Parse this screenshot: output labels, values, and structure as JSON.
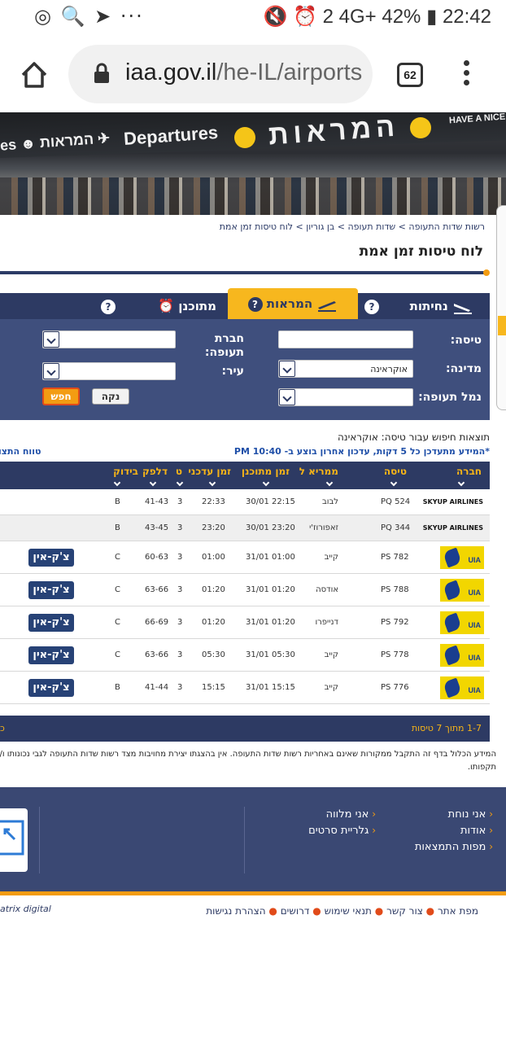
{
  "status_bar": {
    "left_icons": "◎ 🔍 ➤ ···",
    "right_info": "🔇 ⏰ 2 4G+ 42% ▮ 22:42",
    "battery": "42%",
    "time": "22:42"
  },
  "browser": {
    "url_host": "iaa.gov.il",
    "url_path": "/he-IL/airports",
    "tab_count": "62"
  },
  "banner": {
    "sign_hebrew_left": "es ☻ המראות ✈",
    "sign_departures": "Departures",
    "sign_hebrew_main": "המראות",
    "sign_welcome": "HAVE A NICE"
  },
  "breadcrumb": {
    "items": [
      "רשות שדות התעופה",
      "שדות תעופה",
      "בן גוריון",
      "לוח טיסות זמן אמת"
    ],
    "sep": " > "
  },
  "page_title": "לוח טיסות זמן אמת",
  "tabs": {
    "landings": "נחיתות",
    "departures": "המראות",
    "planned": "מתוכנן",
    "help": "?"
  },
  "search": {
    "flight_label": "טיסה:",
    "flight_value": "",
    "country_label": "מדינה:",
    "country_value": "אוקראינה",
    "airport_label": "נמל תעופה:",
    "airport_value": "",
    "airline_label": "חברת תעופה:",
    "airline_value": "",
    "city_label": "עיר:",
    "city_value": "",
    "clear_button": "נקה",
    "search_button": "חפש"
  },
  "results": {
    "header": "תוצאות חיפוש עבור טיסה: אוקראינה",
    "note": "*המידע מתעדכן כל 5 דקות, עדכון אחרון בוצע ב- 10:40 PM",
    "time_range_link": "טווח התצו",
    "columns": [
      "חברה",
      "טיסה",
      "ממריא ל",
      "זמן מתוכנן",
      "זמן עדכני",
      "ט",
      "דלפק",
      "בידוק"
    ],
    "rows": [
      {
        "airline": "SKYUP AIRLINES",
        "logo": false,
        "flight": "PQ 524",
        "dest": "לבוב",
        "scheduled": "22:15 30/01",
        "updated": "22:33",
        "terminal": "3",
        "counter": "41-43",
        "check": "B",
        "checkin": ""
      },
      {
        "airline": "SKYUP AIRLINES",
        "logo": false,
        "flight": "PQ 344",
        "dest": "זאפורוז'י",
        "scheduled": "23:20 30/01",
        "updated": "23:20",
        "terminal": "3",
        "counter": "43-45",
        "check": "B",
        "checkin": ""
      },
      {
        "airline": "UIA",
        "logo": true,
        "flight": "PS 782",
        "dest": "קייב",
        "scheduled": "01:00 31/01",
        "updated": "01:00",
        "terminal": "3",
        "counter": "60-63",
        "check": "C",
        "checkin": "צ'ק-אין"
      },
      {
        "airline": "UIA",
        "logo": true,
        "flight": "PS 788",
        "dest": "אודסה",
        "scheduled": "01:20 31/01",
        "updated": "01:20",
        "terminal": "3",
        "counter": "63-66",
        "check": "C",
        "checkin": "צ'ק-אין"
      },
      {
        "airline": "UIA",
        "logo": true,
        "flight": "PS 792",
        "dest": "דנייפרו",
        "scheduled": "01:20 31/01",
        "updated": "01:20",
        "terminal": "3",
        "counter": "66-69",
        "check": "C",
        "checkin": "צ'ק-אין"
      },
      {
        "airline": "UIA",
        "logo": true,
        "flight": "PS 778",
        "dest": "קייב",
        "scheduled": "05:30 31/01",
        "updated": "05:30",
        "terminal": "3",
        "counter": "63-66",
        "check": "C",
        "checkin": "צ'ק-אין"
      },
      {
        "airline": "UIA",
        "logo": true,
        "flight": "PS 776",
        "dest": "קייב",
        "scheduled": "15:15 31/01",
        "updated": "15:15",
        "terminal": "3",
        "counter": "41-44",
        "check": "B",
        "checkin": "צ'ק-אין"
      }
    ],
    "footer_count": "1-7 מתוך 7 טיסות",
    "footer_more": "כ"
  },
  "disclaimer": "המידע הכלול בדף זה התקבל ממקורות שאינם באחריות רשות שדות התעופה. אין בהצגתו יצירת מחויבות מצד רשות שדות התעופה לגבי נכונותו ו/או תקפותו.",
  "footer": {
    "col1": [
      "אני נוחת",
      "אודות",
      "מפות התמצאות"
    ],
    "col2": [
      "אני מלווה",
      "גלריית סרטים"
    ],
    "bottom_links": [
      "מפת אתר",
      "צור קשר",
      "תנאי שימוש",
      "דרושים",
      "הצהרת נגישות"
    ],
    "logo_text": "atrix digital"
  }
}
